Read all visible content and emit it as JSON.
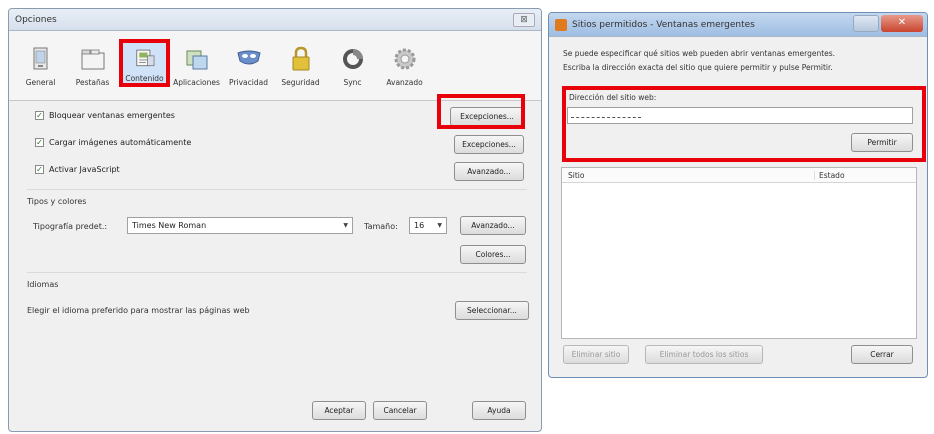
{
  "options_window": {
    "title": "Opciones",
    "close_label": "⊠",
    "tabs": [
      {
        "label": "General"
      },
      {
        "label": "Pestañas"
      },
      {
        "label": "Contenido"
      },
      {
        "label": "Aplicaciones"
      },
      {
        "label": "Privacidad"
      },
      {
        "label": "Seguridad"
      },
      {
        "label": "Sync"
      },
      {
        "label": "Avanzado"
      }
    ],
    "content": {
      "block_popups": {
        "label": "Bloquear ventanas emergentes",
        "checked": true
      },
      "load_images": {
        "label": "Cargar imágenes automáticamente",
        "checked": true
      },
      "enable_js": {
        "label": "Activar JavaScript",
        "checked": true
      },
      "exceptions_1": "Excepciones...",
      "exceptions_2": "Excepciones...",
      "advanced_js": "Avanzado...",
      "fonts_section": "Tipos y colores",
      "default_font_label": "Tipografía predet.:",
      "default_font_value": "Times New Roman",
      "size_label": "Tamaño:",
      "size_value": "16",
      "advanced_fonts": "Avanzado...",
      "colors": "Colores...",
      "languages_section": "Idiomas",
      "languages_desc": "Elegir el idioma preferido para mostrar las páginas web",
      "select_lang": "Seleccionar..."
    },
    "footer": {
      "accept": "Aceptar",
      "cancel": "Cancelar",
      "help": "Ayuda"
    }
  },
  "popup_window": {
    "title": "Sitios permitidos - Ventanas emergentes",
    "close_label": "✕",
    "description_1": "Se puede especificar qué sitios web pueden abrir ventanas emergentes.",
    "description_2": "Escriba la dirección exacta del sitio que quiere permitir y pulse Permitir.",
    "address_label": "Dirección del sitio web:",
    "address_value": "",
    "allow": "Permitir",
    "col_site": "Sitio",
    "col_status": "Estado",
    "remove_site": "Eliminar sitio",
    "remove_all": "Eliminar todos los sitios",
    "close": "Cerrar"
  },
  "colors": {
    "highlight": "#e8000b",
    "active_tab": "#cfe2f7"
  }
}
